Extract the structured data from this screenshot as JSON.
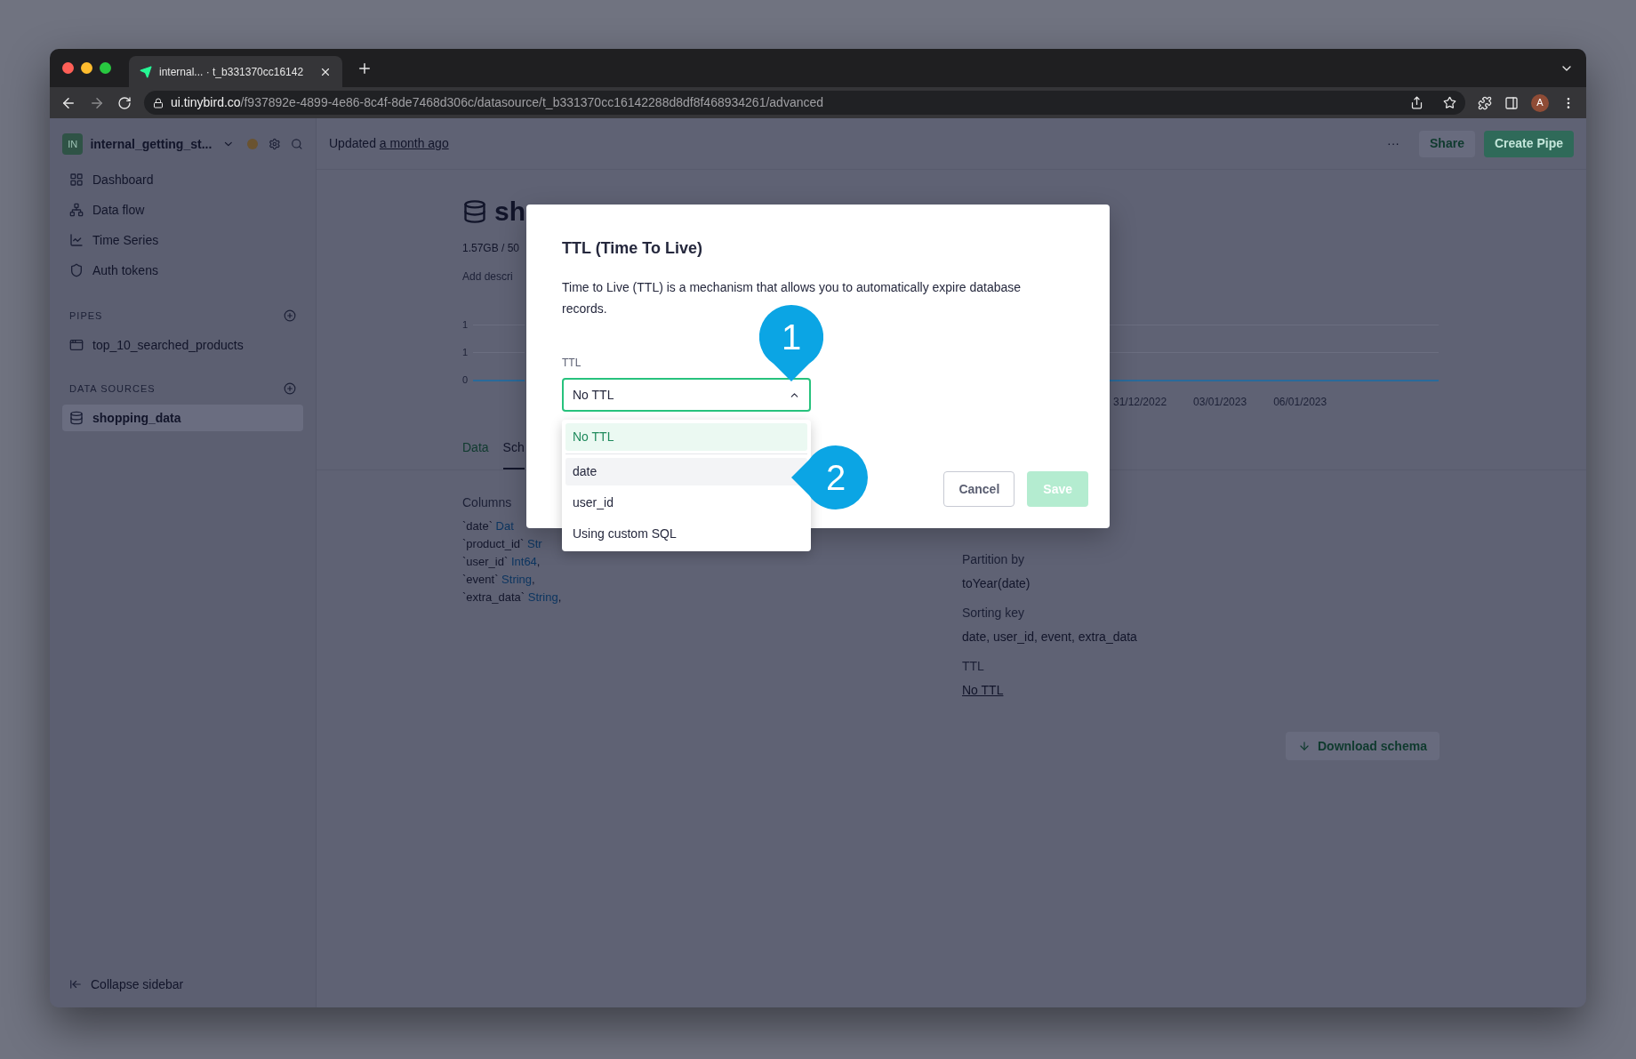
{
  "browser": {
    "tab_title": "internal... · t_b331370cc16142",
    "url_host": "ui.tinybird.co",
    "url_path": "/f937892e-4899-4e86-8c4f-8de7468d306c/datasource/t_b331370cc16142288d8df8f468934261/advanced",
    "avatar": "A"
  },
  "sidebar": {
    "workspace_initials": "IN",
    "workspace_name": "internal_getting_st...",
    "nav": [
      {
        "label": "Dashboard"
      },
      {
        "label": "Data flow"
      },
      {
        "label": "Time Series"
      },
      {
        "label": "Auth tokens"
      }
    ],
    "sections": [
      {
        "title": "PIPES",
        "items": [
          {
            "label": "top_10_searched_products",
            "selected": false
          }
        ]
      },
      {
        "title": "DATA SOURCES",
        "items": [
          {
            "label": "shopping_data",
            "selected": true
          }
        ]
      }
    ],
    "collapse": "Collapse sidebar"
  },
  "header": {
    "updated_prefix": "Updated",
    "updated_link": "a month ago",
    "more": "···",
    "share": "Share",
    "create": "Create Pipe"
  },
  "datasource": {
    "title": "sh",
    "stats": "1.57GB / 50",
    "description": "Add descri",
    "chart": {
      "y_tick_labels": [
        "1",
        "1",
        "0"
      ],
      "x_tick_labels": [
        "31/12/2022",
        "03/01/2023",
        "06/01/2023"
      ]
    },
    "tabs": [
      {
        "label": "Data",
        "selected": false
      },
      {
        "label": "Sch",
        "selected": true
      }
    ],
    "columns_title": "Columns",
    "columns": [
      {
        "name": "`date`",
        "type": "Dat"
      },
      {
        "name": "`product_id`",
        "type": "Str"
      },
      {
        "name": "`user_id`",
        "type": "Int64",
        "punct": ","
      },
      {
        "name": "`event`",
        "type": "String",
        "punct": ","
      },
      {
        "name": "`extra_data`",
        "type": "String",
        "punct": ","
      }
    ],
    "settings": [
      {
        "label": "Partition by",
        "value": "toYear(date)",
        "link": false
      },
      {
        "label": "Sorting key",
        "value": "date, user_id, event, extra_data",
        "link": false
      },
      {
        "label": "TTL",
        "value": "No TTL",
        "link": true
      }
    ],
    "download": "Download schema"
  },
  "modal": {
    "title": "TTL (Time To Live)",
    "description": "Time to Live (TTL) is a mechanism that allows you to automatically expire database records.",
    "field_label": "TTL",
    "value": "No TTL",
    "expanded": true,
    "options": [
      {
        "label": "No TTL",
        "selected": true,
        "highlighted": false
      },
      {
        "label": "date",
        "selected": false,
        "highlighted": true
      },
      {
        "label": "user_id",
        "selected": false,
        "highlighted": false
      },
      {
        "label": "Using custom SQL",
        "selected": false,
        "highlighted": false
      }
    ],
    "cancel": "Cancel",
    "save": {
      "label": "Save",
      "disabled": true
    }
  },
  "callouts": [
    "1",
    "2"
  ]
}
